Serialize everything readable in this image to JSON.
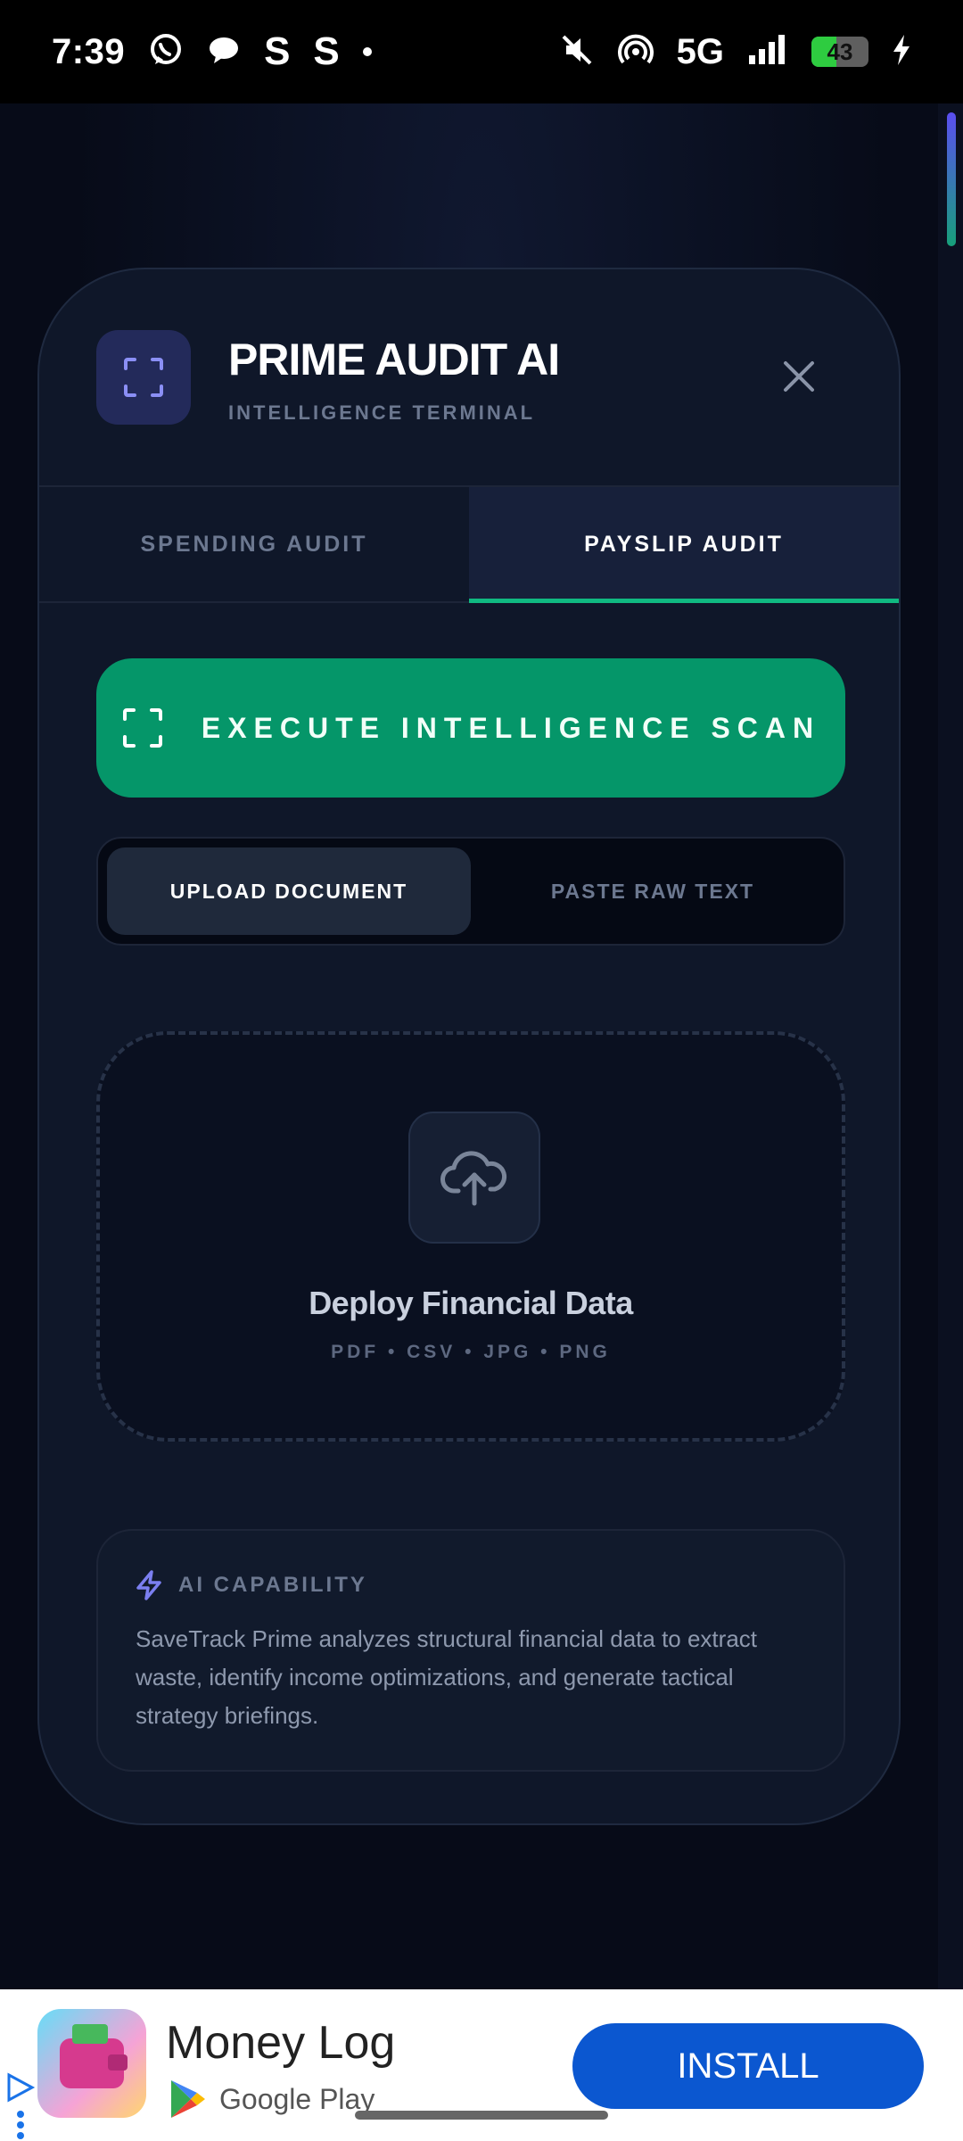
{
  "status_bar": {
    "time": "7:39",
    "icons": [
      "whatsapp-icon",
      "chat-bubble-icon",
      "s-app-icon",
      "s-app-icon",
      "dot-icon"
    ],
    "s_letter_1": "S",
    "s_letter_2": "S",
    "network": "5G",
    "battery_level": "43",
    "battery_percent": 43,
    "right_icons": [
      "mute-icon",
      "hotspot-icon",
      "signal-icon",
      "battery-icon",
      "charging-bolt-icon"
    ]
  },
  "modal": {
    "title": "PRIME AUDIT AI",
    "subtitle": "INTELLIGENCE TERMINAL",
    "logo_icon": "scan-frame-icon",
    "close_icon": "close-icon",
    "tabs": [
      {
        "label": "SPENDING AUDIT",
        "active": false
      },
      {
        "label": "PAYSLIP AUDIT",
        "active": true
      }
    ],
    "scan_button_label": "EXECUTE INTELLIGENCE SCAN",
    "input_modes": [
      {
        "label": "UPLOAD DOCUMENT",
        "active": true
      },
      {
        "label": "PASTE RAW TEXT",
        "active": false
      }
    ],
    "dropzone": {
      "icon": "cloud-upload-icon",
      "title": "Deploy Financial Data",
      "formats": "PDF • CSV • JPG • PNG"
    },
    "info": {
      "icon": "lightning-icon",
      "title": "AI CAPABILITY",
      "text": "SaveTrack Prime analyzes structural financial data to extract waste, identify income optimizations, and generate tactical strategy briefings."
    }
  },
  "ad": {
    "app_name": "Money Log",
    "store": "Google Play",
    "install_label": "INSTALL"
  },
  "colors": {
    "accent_green": "#059669",
    "tab_underline": "#10b981",
    "logo_bg": "#232a5a",
    "install_blue": "#0b57d0"
  }
}
